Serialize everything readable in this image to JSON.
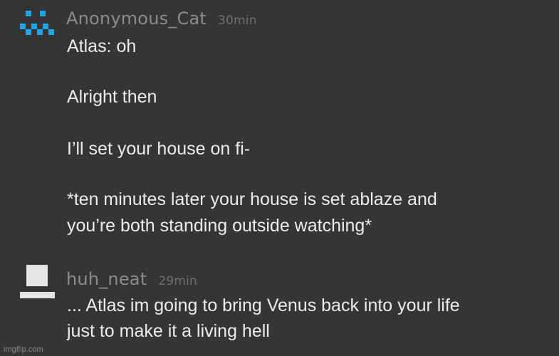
{
  "comments": [
    {
      "username": "Anonymous_Cat",
      "time": "30min",
      "avatar_icon": "pixel-face-avatar-icon",
      "avatar_color": "#1fa6e0",
      "lines": [
        "Atlas: oh",
        "Alright then",
        "I’ll set your house on fi-",
        "*ten minutes later your house is set ablaze and",
        "you’re both standing outside watching*"
      ]
    },
    {
      "username": "huh_neat",
      "time": "29min",
      "avatar_icon": "top-hat-avatar-icon",
      "avatar_color": "#e6e6e6",
      "lines": [
        "... Atlas im going to bring Venus back into your life",
        "just to make it a living hell"
      ]
    }
  ],
  "watermark": "imgflip.com"
}
